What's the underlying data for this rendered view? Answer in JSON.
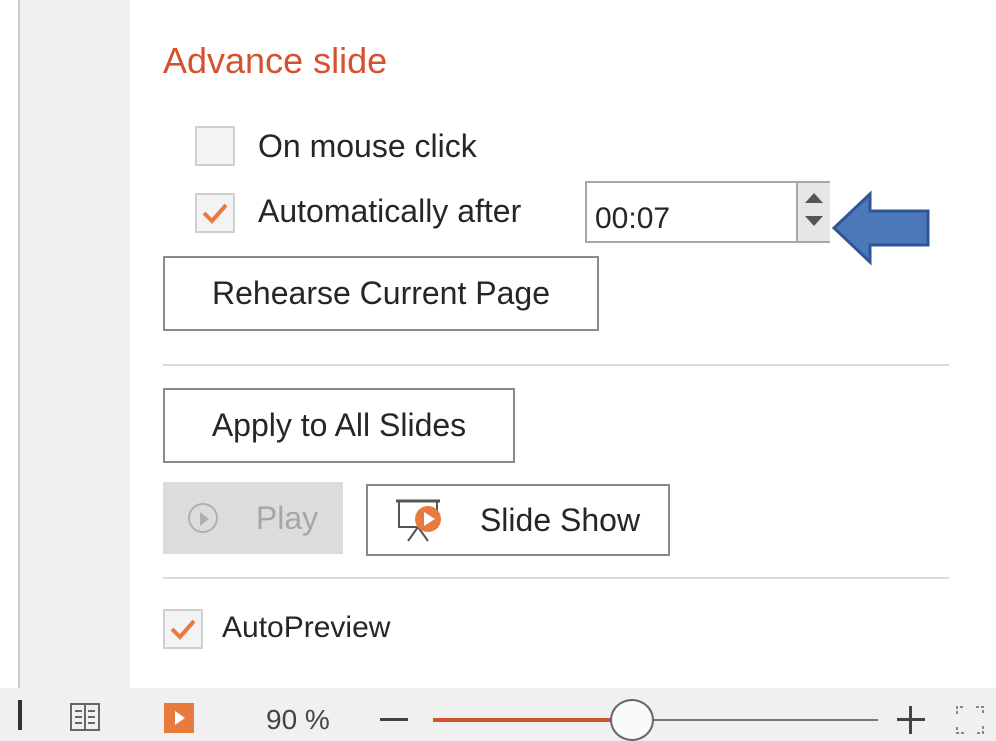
{
  "section": {
    "title": "Advance slide"
  },
  "advance": {
    "on_mouse_click": {
      "label": "On mouse click",
      "checked": false
    },
    "automatically_after": {
      "label": "Automatically after",
      "checked": true,
      "value": "00:07"
    }
  },
  "buttons": {
    "rehearse": "Rehearse Current Page",
    "apply_all": "Apply to All Slides",
    "play": "Play",
    "slide_show": "Slide Show"
  },
  "autopreview": {
    "label": "AutoPreview",
    "checked": true
  },
  "status_bar": {
    "zoom_label": "90 %",
    "zoom_percent": 90
  },
  "colors": {
    "accent": "#d35230",
    "arrow": "#4a78b8",
    "check": "#e87a3e"
  },
  "icons": [
    "checkmark-icon",
    "spinner-up-icon",
    "spinner-down-icon",
    "blue-arrow-icon",
    "play-circle-icon",
    "slide-show-icon",
    "reading-view-icon",
    "slideshow-view-icon",
    "fit-to-window-icon"
  ]
}
